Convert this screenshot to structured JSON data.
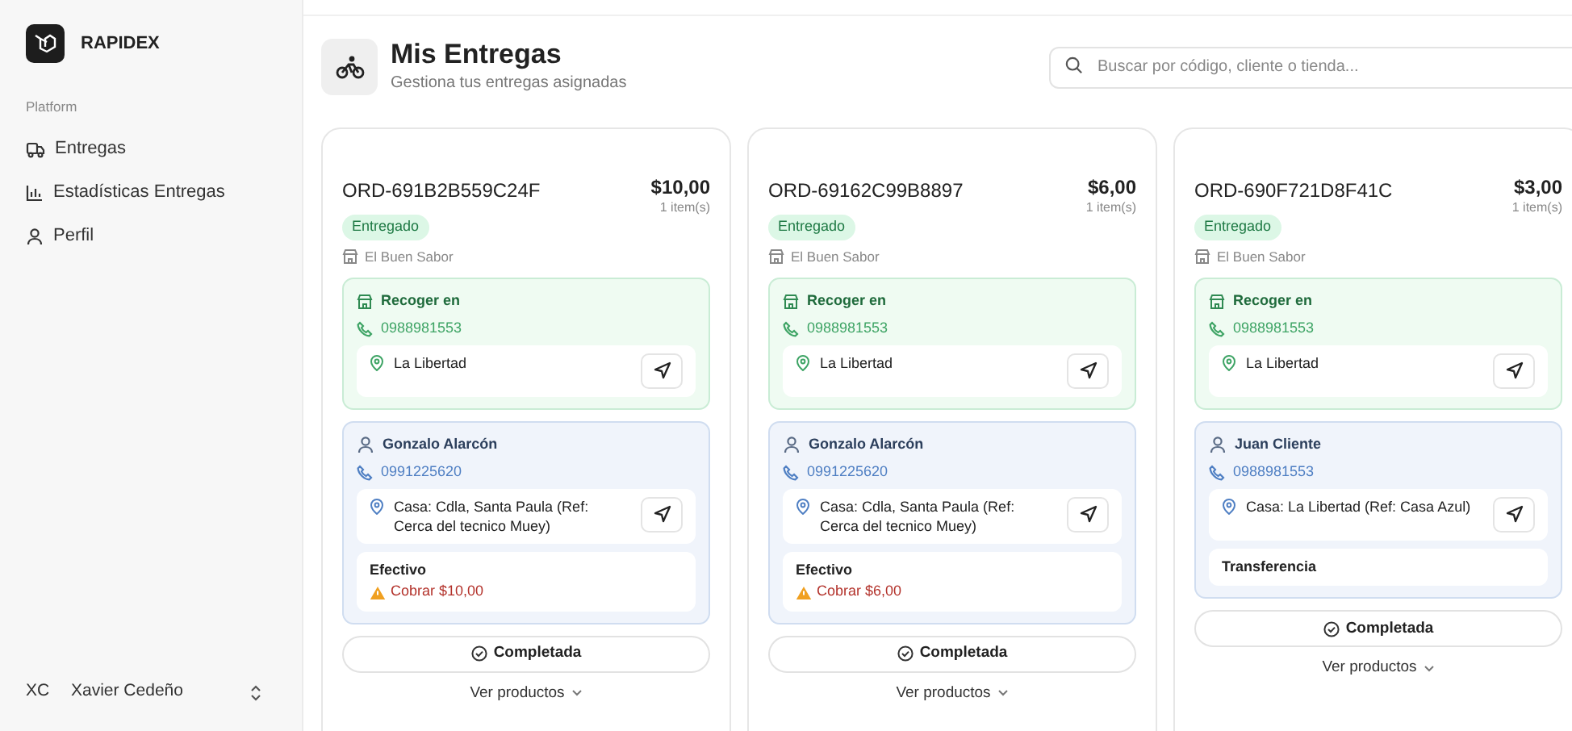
{
  "sidebar": {
    "brand": "RAPIDEX",
    "section_label": "Platform",
    "items": [
      {
        "kind": "truck",
        "label": "Entregas"
      },
      {
        "kind": "chart",
        "label": "Estadísticas Entregas"
      },
      {
        "kind": "user",
        "label": "Perfil"
      }
    ],
    "user": {
      "initials": "XC",
      "name": "Xavier Cedeño"
    }
  },
  "header": {
    "title": "Mis Entregas",
    "subtitle": "Gestiona tus entregas asignadas"
  },
  "search": {
    "placeholder": "Buscar por código, cliente o tienda..."
  },
  "orders": [
    {
      "code": "ORD-691B2B559C24F",
      "total": "$10,00",
      "items": "1 item(s)",
      "status": "Entregado",
      "store": "El Buen Sabor",
      "pickup": {
        "title": "Recoger en",
        "phone": "0988981553",
        "address": "La Libertad"
      },
      "customer": {
        "name": "Gonzalo Alarcón",
        "phone": "0991225620",
        "address": "Casa: Cdla, Santa Paula (Ref: Cerca del tecnico Muey)"
      },
      "payment": {
        "method": "Efectivo",
        "note": "Cobrar $10,00"
      },
      "action": "Completada",
      "products": "Ver productos"
    },
    {
      "code": "ORD-69162C99B8897",
      "total": "$6,00",
      "items": "1 item(s)",
      "status": "Entregado",
      "store": "El Buen Sabor",
      "pickup": {
        "title": "Recoger en",
        "phone": "0988981553",
        "address": "La Libertad"
      },
      "customer": {
        "name": "Gonzalo Alarcón",
        "phone": "0991225620",
        "address": "Casa: Cdla, Santa Paula (Ref: Cerca del tecnico Muey)"
      },
      "payment": {
        "method": "Efectivo",
        "note": "Cobrar $6,00"
      },
      "action": "Completada",
      "products": "Ver productos"
    },
    {
      "code": "ORD-690F721D8F41C",
      "total": "$3,00",
      "items": "1 item(s)",
      "status": "Entregado",
      "store": "El Buen Sabor",
      "pickup": {
        "title": "Recoger en",
        "phone": "0988981553",
        "address": "La Libertad"
      },
      "customer": {
        "name": "Juan Cliente",
        "phone": "0988981553",
        "address": "Casa: La Libertad (Ref: Casa Azul)"
      },
      "payment": {
        "method": "Transferencia"
      },
      "action": "Completada",
      "products": "Ver productos"
    }
  ]
}
